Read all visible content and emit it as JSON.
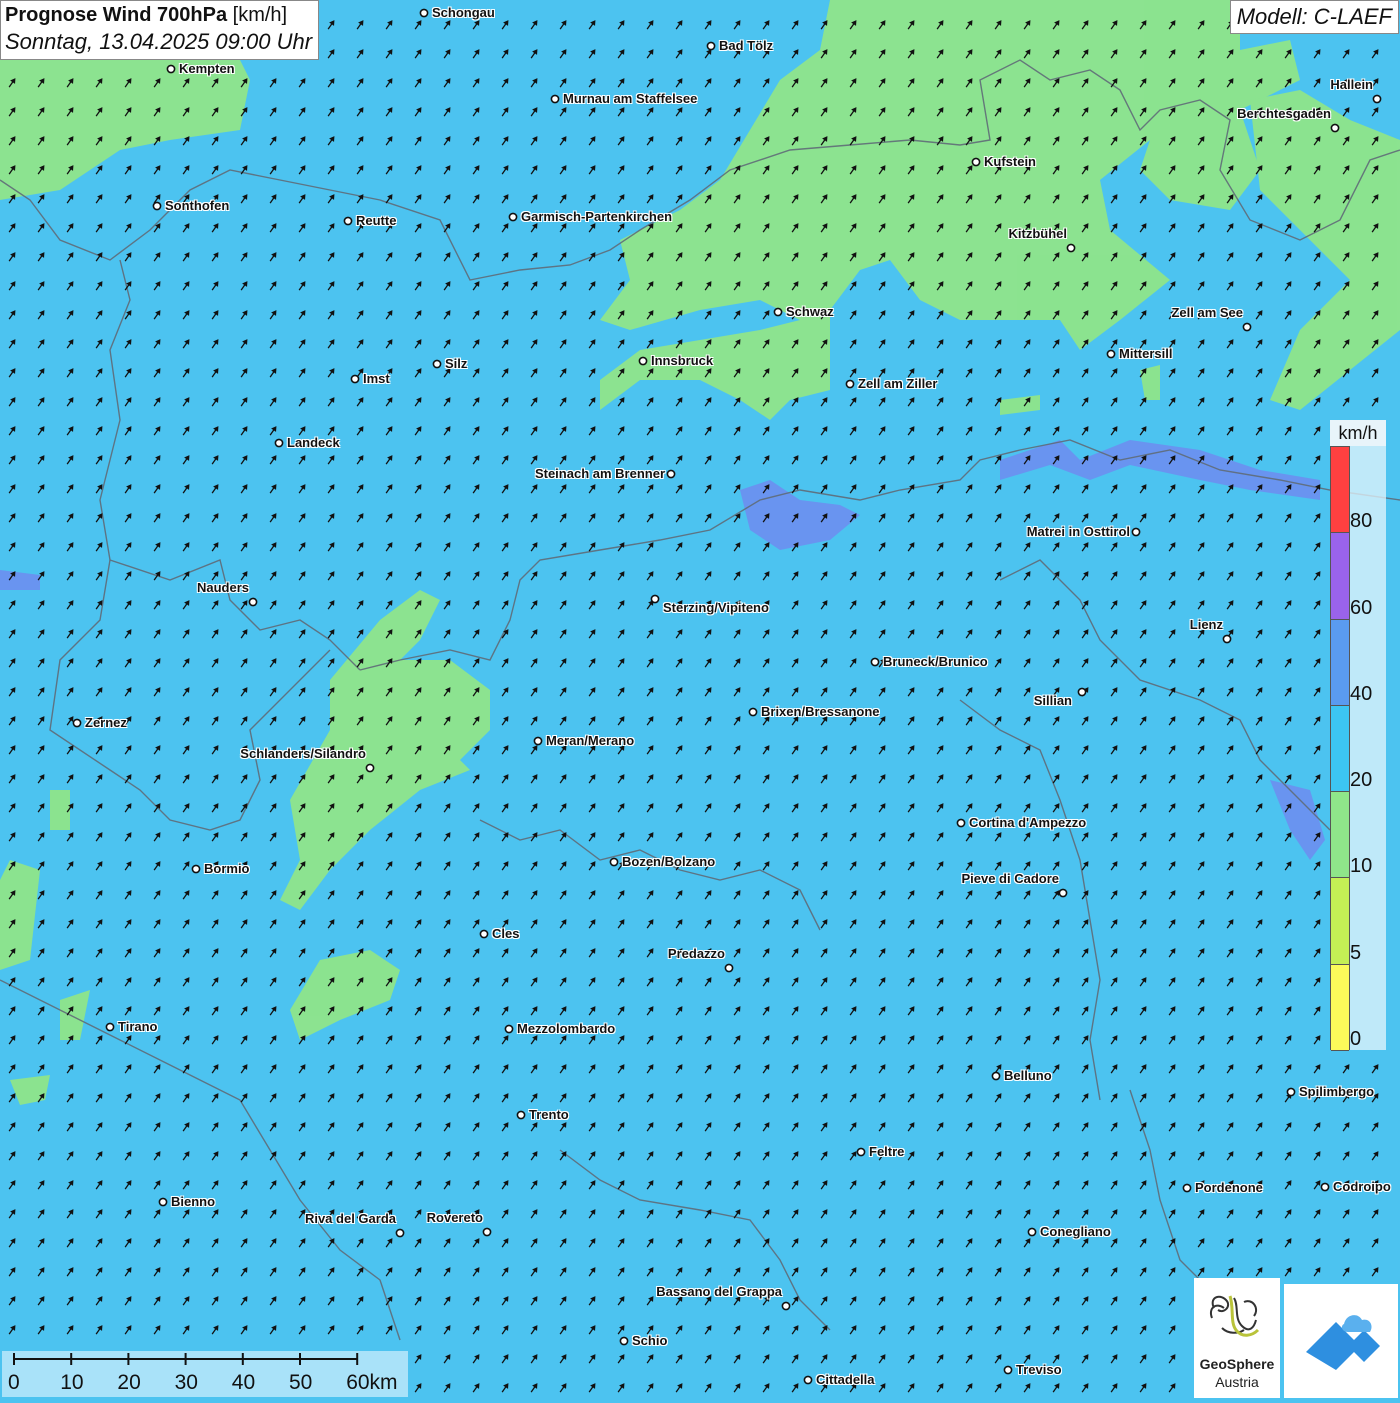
{
  "header": {
    "title": "Prognose Wind 700hPa",
    "unit": "[km/h]",
    "datetime": "Sonntag, 13.04.2025 09:00 Uhr"
  },
  "model": "Modell: C-LAEF",
  "legend": {
    "unit": "km/h",
    "ticks": [
      "0",
      "5",
      "10",
      "20",
      "40",
      "60",
      "80"
    ],
    "colors": [
      "#fbfa5a",
      "#c4ef55",
      "#8fe58a",
      "#3cc6f3",
      "#5a9bf0",
      "#9a63eb",
      "#ff4040"
    ]
  },
  "scale": {
    "labels": [
      "0",
      "10",
      "20",
      "30",
      "40",
      "50",
      "60km"
    ]
  },
  "colors": {
    "wind_10_20": "#8fe58a",
    "wind_20_40": "#3cc6f3",
    "wind_40_60": "#6e8cf0",
    "border": "#5f6b78"
  },
  "wind_direction": "from south-west",
  "cities": [
    {
      "name": "Schongau"
    },
    {
      "name": "Bad Tölz"
    },
    {
      "name": "Kempten"
    },
    {
      "name": "Murnau am Staffelsee"
    },
    {
      "name": "Hallein"
    },
    {
      "name": "Berchtesgaden"
    },
    {
      "name": "Kufstein"
    },
    {
      "name": "Sonthofen"
    },
    {
      "name": "Reutte"
    },
    {
      "name": "Garmisch-Partenkirchen"
    },
    {
      "name": "Kitzbühel"
    },
    {
      "name": "Schwaz"
    },
    {
      "name": "Zell am See"
    },
    {
      "name": "Mittersill"
    },
    {
      "name": "Innsbruck"
    },
    {
      "name": "Imst"
    },
    {
      "name": "Silz"
    },
    {
      "name": "Zell am Ziller"
    },
    {
      "name": "Landeck"
    },
    {
      "name": "Steinach am Brenner"
    },
    {
      "name": "Matrei in Osttirol"
    },
    {
      "name": "Nauders"
    },
    {
      "name": "Sterzing/Vipiteno"
    },
    {
      "name": "Lienz"
    },
    {
      "name": "Bruneck/Brunico"
    },
    {
      "name": "Sillian"
    },
    {
      "name": "Zernez"
    },
    {
      "name": "Brixen/Bressanone"
    },
    {
      "name": "Meran/Merano"
    },
    {
      "name": "Schlanders/Silandro"
    },
    {
      "name": "Cortina d'Ampezzo"
    },
    {
      "name": "Bormio"
    },
    {
      "name": "Bozen/Bolzano"
    },
    {
      "name": "Pieve di Cadore"
    },
    {
      "name": "Cles"
    },
    {
      "name": "Predazzo"
    },
    {
      "name": "Tirano"
    },
    {
      "name": "Mezzolombardo"
    },
    {
      "name": "Belluno"
    },
    {
      "name": "Spilimbergo"
    },
    {
      "name": "Trento"
    },
    {
      "name": "Feltre"
    },
    {
      "name": "Pordenone"
    },
    {
      "name": "Codroipo"
    },
    {
      "name": "Bienno"
    },
    {
      "name": "Riva del Garda"
    },
    {
      "name": "Rovereto"
    },
    {
      "name": "Conegliano"
    },
    {
      "name": "Bassano del Grappa"
    },
    {
      "name": "Schio"
    },
    {
      "name": "Treviso"
    },
    {
      "name": "Cittadella"
    }
  ],
  "logos": {
    "geosphere_name": "GeoSphere",
    "geosphere_sub": "Austria"
  }
}
